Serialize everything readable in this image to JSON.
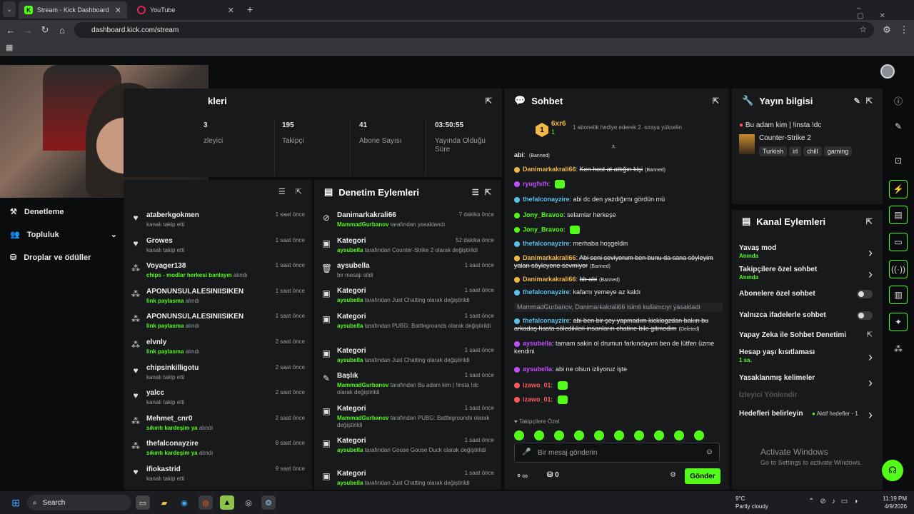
{
  "browser": {
    "tabs": [
      {
        "title": "Stream - Kick Dashboard",
        "active": true
      },
      {
        "title": "YouTube",
        "active": false
      }
    ],
    "url": "dashboard.kick.com/stream"
  },
  "stats": {
    "title_partial": "kleri",
    "items": [
      {
        "value": "3",
        "label": "zleyici"
      },
      {
        "value": "195",
        "label": "Takipçi"
      },
      {
        "value": "41",
        "label": "Abone Sayısı"
      },
      {
        "value": "03:50:55",
        "label": "Yayında Olduğu Süre"
      }
    ]
  },
  "sidebar": {
    "items": [
      "Denetleme",
      "Topluluk",
      "Droplar ve ödüller"
    ]
  },
  "activity": {
    "rows": [
      {
        "name": "ataberkgokmen",
        "sub": "kanalı takip etti",
        "sub_green": "",
        "time": "1 saat önce",
        "icon": "heart"
      },
      {
        "name": "Growes",
        "sub": "kanalı takip etti",
        "sub_green": "",
        "time": "1 saat önce",
        "icon": "heart"
      },
      {
        "name": "Voyager138",
        "sub_green": "chips - modlar herkesi banlayın",
        "sub": " alındı",
        "time": "1 saat önce",
        "icon": "reward"
      },
      {
        "name": "APONUNSULALESINIISIKEN",
        "sub_green": "link paylasma",
        "sub": " alındı",
        "time": "1 saat önce",
        "icon": "reward"
      },
      {
        "name": "APONUNSULALESINIISIKEN",
        "sub_green": "link paylasma",
        "sub": " alındı",
        "time": "1 saat önce",
        "icon": "reward"
      },
      {
        "name": "elvnly",
        "sub_green": "link paylasma",
        "sub": " alındı",
        "time": "2 saat önce",
        "icon": "reward"
      },
      {
        "name": "chipsinkilligotu",
        "sub": "kanalı takip etti",
        "sub_green": "",
        "time": "2 saat önce",
        "icon": "heart"
      },
      {
        "name": "yalcc",
        "sub": "kanalı takip etti",
        "sub_green": "",
        "time": "2 saat önce",
        "icon": "heart"
      },
      {
        "name": "Mehmet_cnr0",
        "sub_green": "sıkıntı kardeşim ya",
        "sub": " alındı",
        "time": "2 saat önce",
        "icon": "reward"
      },
      {
        "name": "thefalconayzire",
        "sub_green": "sıkıntı kardeşim ya",
        "sub": " alındı",
        "time": "8 saat önce",
        "icon": "reward"
      },
      {
        "name": "ifiokastrid",
        "sub": "kanalı takip etti",
        "sub_green": "",
        "time": "9 saat önce",
        "icon": "heart"
      }
    ]
  },
  "moderation": {
    "title": "Denetim Eylemleri",
    "rows": [
      {
        "name": "Danimarkakrali66",
        "green": "MammadGurbanov",
        "rest": " tarafından yasaklandı",
        "time": "7 dakika önce",
        "icon": "⊘"
      },
      {
        "name": "Kategori",
        "green": "aysubella",
        "rest": " tarafından Counter-Strike 2 olarak değiştirildi",
        "time": "52 dakika önce",
        "icon": "▣"
      },
      {
        "name": "aysubella",
        "green": "",
        "rest": "bir mesajı sildi",
        "time": "1 saat önce",
        "icon": "🗑"
      },
      {
        "name": "Kategori",
        "green": "aysubella",
        "rest": " tarafından Just Chatting olarak değiştirildi",
        "time": "1 saat önce",
        "icon": "▣"
      },
      {
        "name": "Kategori",
        "green": "aysubella",
        "rest": " tarafından PUBG: Battlegrounds olarak değiştirildi",
        "time": "1 saat önce",
        "icon": "▣"
      },
      {
        "name": "Kategori",
        "green": "aysubella",
        "rest": " tarafından Just Chatting olarak değiştirildi",
        "time": "1 saat önce",
        "icon": "▣"
      },
      {
        "name": "Başlık",
        "green": "MammadGurbanov",
        "rest": " tarafından Bu adam kim | !insta !dc olarak değiştirildi",
        "time": "1 saat önce",
        "icon": "✎"
      },
      {
        "name": "Kategori",
        "green": "MammadGurbanov",
        "rest": " tarafından PUBG: Battlegrounds olarak değiştirildi",
        "time": "1 saat önce",
        "icon": "▣"
      },
      {
        "name": "Kategori",
        "green": "aysubella",
        "rest": " tarafından Goose Goose Duck olarak değiştirildi",
        "time": "1 saat önce",
        "icon": "▣"
      },
      {
        "name": "Kategori",
        "green": "aysubella",
        "rest": " tarafından Just Chatting olarak değiştirildi",
        "time": "1 saat önce",
        "icon": "▣"
      }
    ]
  },
  "chat": {
    "title": "Sohbet",
    "leader": {
      "name": "6xr6",
      "count": "1",
      "rank": "1",
      "note": "1 abonelik hediye ederek 2. sıraya yükselin"
    },
    "lines": [
      {
        "user": "abi",
        "color": "#e6e6e6",
        "text": "",
        "tag": "(Banned)",
        "strike": true
      },
      {
        "user": "Danimarkakrali66",
        "color": "#f2b844",
        "text": "Ken host at attığın kişi",
        "tag": "(Banned)",
        "strike": true
      },
      {
        "user": "ryugfsth",
        "color": "#c64dff",
        "text": "",
        "tag": "",
        "strike": false
      },
      {
        "user": "thefalconayzire",
        "color": "#5bc0eb",
        "text": "abi dc den yazdığımı gördün mü",
        "tag": "",
        "strike": false
      },
      {
        "user": "Jony_Bravoo",
        "color": "#53fc18",
        "text": "selamlar herkeşe",
        "tag": "",
        "strike": false
      },
      {
        "user": "Jony_Bravoo",
        "color": "#53fc18",
        "text": "",
        "tag": "",
        "strike": false
      },
      {
        "user": "thefalconayzire",
        "color": "#5bc0eb",
        "text": "merhaba hoşgeldin",
        "tag": "",
        "strike": false
      },
      {
        "user": "Danimarkakrali66",
        "color": "#f2b844",
        "text": "Abi seni seviyorum ben bunu da sana söyleyim yalan söyleyene sevmiyor",
        "tag": "(Banned)",
        "strike": true
      },
      {
        "user": "Danimarkakrali66",
        "color": "#f2b844",
        "text": "bb abi",
        "tag": "(Banned)",
        "strike": true
      },
      {
        "user": "thefalconayzire",
        "color": "#5bc0eb",
        "text": "kafamı yemeye az kaldı",
        "tag": "",
        "strike": false
      },
      {
        "user": "",
        "color": "#9b9ea3",
        "text": "MammadGurbanov, Danimarkakrali66 isimli kullanıcıyı yasakladı",
        "tag": "",
        "strike": false
      },
      {
        "user": "thefalconayzire",
        "color": "#5bc0eb",
        "text": "abi ben bir şey yapmadım kicklogzdan bakın bu arkadaş hasta söledikleri insanların chatine bile gitmedim",
        "tag": "(Deleted)",
        "strike": true
      },
      {
        "user": "aysubella",
        "color": "#c64dff",
        "text": "tamam sakin ol drumun farkındayım ben de lütfen üzme kendini",
        "tag": "",
        "strike": false
      },
      {
        "user": "aysubella",
        "color": "#c64dff",
        "text": "abi ne olsun izliyoruz işte",
        "tag": "",
        "strike": false
      },
      {
        "user": "izawo_01",
        "color": "#ff5a5a",
        "text": "",
        "tag": "",
        "strike": false
      },
      {
        "user": "izawo_01",
        "color": "#ff5a5a",
        "text": "",
        "tag": "",
        "strike": false
      }
    ],
    "followers_label": "Takipçilere Özel",
    "input_placeholder": "Bir mesaj gönderin",
    "points": "0",
    "send_label": "Gönder"
  },
  "stream_info": {
    "title": "Yayın bilgisi",
    "stream_title": "Bu adam kim | !insta !dc",
    "category": "Counter-Strike 2",
    "tags": [
      "Turkish",
      "irl",
      "chill",
      "gaming"
    ]
  },
  "channel_actions": {
    "title": "Kanal Eylemleri",
    "items": [
      {
        "label": "Yavaş mod",
        "sub": "Anında",
        "type": "chevron"
      },
      {
        "label": "Takipçilere özel sohbet",
        "sub": "Anında",
        "type": "chevron"
      },
      {
        "label": "Abonelere özel sohbet",
        "sub": "",
        "type": "toggle"
      },
      {
        "label": "Yalnızca ifadelerle sohbet",
        "sub": "",
        "type": "toggle"
      },
      {
        "label": "Yapay Zeka ile Sohbet Denetimi",
        "sub": "",
        "type": "external"
      },
      {
        "label": "Hesap yaşı kısıtlaması",
        "sub": "1 sa.",
        "type": "chevron"
      },
      {
        "label": "Yasaklanmış kelimeler",
        "sub": "",
        "type": "chevron"
      },
      {
        "label": "İzleyici Yönlendir",
        "sub": "",
        "type": "disabled"
      },
      {
        "label": "Hedefleri belirleyin",
        "sub": "",
        "type": "goal",
        "goal_text": "Aktif hedefler - 1"
      }
    ]
  },
  "watermark": {
    "line1": "Activate Windows",
    "line2": "Go to Settings to activate Windows."
  },
  "taskbar": {
    "search": "Search",
    "weather_temp": "9°C",
    "weather_text": "Partly cloudy",
    "time": "11:19 PM",
    "date": "4/9/2026"
  },
  "colors": {
    "accent": "#53fc18",
    "panel": "#18191b",
    "bg": "#0b0c0d"
  }
}
